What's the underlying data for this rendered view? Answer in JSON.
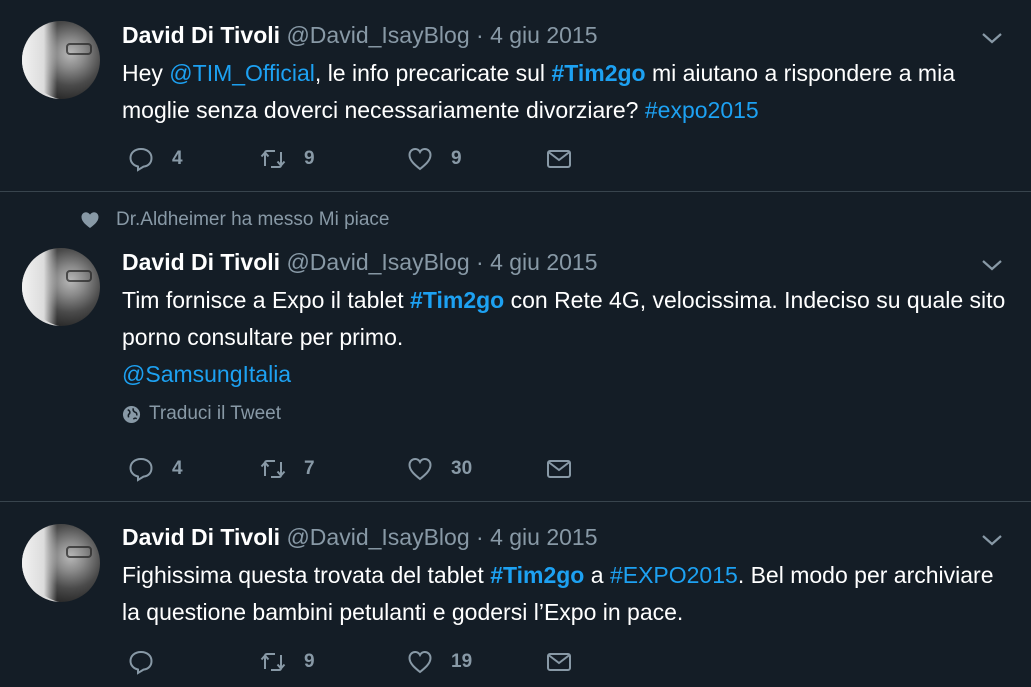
{
  "tweets": [
    {
      "author": "David Di Tivoli",
      "handle": "@David_IsayBlog",
      "separator": "·",
      "date": "4 giu 2015",
      "text": {
        "p1": "Hey ",
        "mention": "@TIM_Official",
        "p2": ", le info precaricate sul ",
        "hashtag": "#Tim2go",
        "p3": " mi aiutano a rispondere a mia moglie senza doverci necessariamente divorziare? ",
        "hashtag2": "#expo2015"
      },
      "replies": "4",
      "retweets": "9",
      "likes": "9"
    },
    {
      "social_context": "Dr.Aldheimer ha messo Mi piace",
      "author": "David Di Tivoli",
      "handle": "@David_IsayBlog",
      "separator": "·",
      "date": "4 giu 2015",
      "text": {
        "p1": "Tim fornisce a Expo il tablet ",
        "hashtag": "#Tim2go",
        "p2": " con Rete 4G, velocissima. Indeciso su quale sito porno consultare per primo.",
        "mention": "@SamsungItalia"
      },
      "translate": "Traduci il Tweet",
      "replies": "4",
      "retweets": "7",
      "likes": "30"
    },
    {
      "author": "David Di Tivoli",
      "handle": "@David_IsayBlog",
      "separator": "·",
      "date": "4 giu 2015",
      "text": {
        "p1": "Fighissima questa trovata del tablet ",
        "hashtag": "#Tim2go",
        "p2": " a ",
        "hashtag2": "#EXPO2015",
        "p3": ". Bel modo per archiviare la questione bambini petulanti e godersi l’Expo in pace."
      },
      "replies": "",
      "retweets": "9",
      "likes": "19"
    }
  ],
  "colors": {
    "background": "#141d26",
    "accent": "#1da1f2",
    "muted": "#8899a6",
    "divider": "#38444d"
  },
  "icons": [
    "chevron-down-icon",
    "reply-icon",
    "retweet-icon",
    "heart-icon",
    "direct-message-icon",
    "globe-icon"
  ]
}
